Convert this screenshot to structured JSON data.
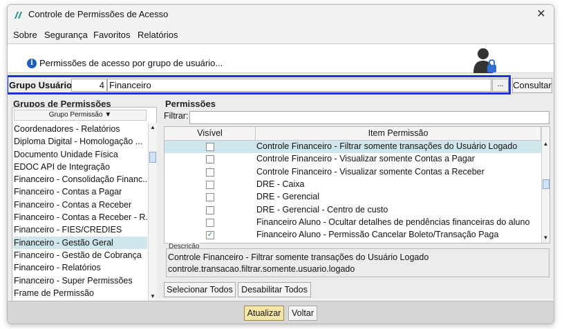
{
  "window": {
    "title": "Controle de Permissões de Acesso",
    "close_glyph": "✕"
  },
  "menu": [
    "Sobre",
    "Segurança",
    "Favoritos",
    "Relatórios"
  ],
  "info": {
    "text": "Permissões de acesso por grupo de usuário...",
    "icon": "info-icon"
  },
  "group": {
    "label": "Grupo Usuário:",
    "id": "4",
    "name": "Financeiro",
    "lookup_label": "...",
    "consult_label": "Consultar"
  },
  "left_panel": {
    "title": "Grupos de Permissões",
    "column_header": "Grupo Permissão ▼",
    "items": [
      "Coordenadores - Relatórios",
      "Diploma Digital - Homologação ...",
      "Documento Unidade Física",
      "EDOC API de Integração",
      "Financeiro - Consolidação Financ...",
      "Financeiro - Contas a Pagar",
      "Financeiro - Contas a Receber",
      "Financeiro - Contas a Receber - R...",
      "Financeiro - FIES/CREDIES",
      "Financeiro - Gestão Geral",
      "Financeiro - Gestão de Cobrança",
      "Financeiro - Relatórios",
      "Financeiro - Super Permissões",
      "Frame de Permissão"
    ],
    "selected_index": 9
  },
  "right_panel": {
    "title": "Permissões",
    "filter_label": "Filtrar:",
    "filter_value": "",
    "columns": [
      "Visível",
      "Item Permissão"
    ],
    "rows": [
      {
        "visible": false,
        "item": "Controle Financeiro - Filtrar somente transações do Usuário Logado",
        "selected": true
      },
      {
        "visible": false,
        "item": "Controle Financeiro - Visualizar somente Contas a Pagar",
        "selected": false
      },
      {
        "visible": false,
        "item": "Controle Financeiro - Visualizar somente Contas a Receber",
        "selected": false
      },
      {
        "visible": false,
        "item": "DRE - Caixa",
        "selected": false
      },
      {
        "visible": false,
        "item": "DRE - Gerencial",
        "selected": false
      },
      {
        "visible": false,
        "item": "DRE - Gerencial - Centro de custo",
        "selected": false
      },
      {
        "visible": false,
        "item": "Financeiro Aluno - Ocultar detalhes de pendências financeiras do aluno",
        "selected": false
      },
      {
        "visible": true,
        "item": "Financeiro Aluno - Permissão Cancelar Boleto/Transação Paga",
        "selected": false
      }
    ],
    "description": {
      "label": "Descrição",
      "line1": "Controle Financeiro - Filtrar somente transações do Usuário Logado",
      "line2": "controle.transacao.filtrar.somente.usuario.logado"
    },
    "select_all_label": "Selecionar Todos",
    "disable_all_label": "Desabilitar Todos"
  },
  "footer": {
    "update_label": "Atualizar",
    "back_label": "Voltar"
  },
  "colors": {
    "accent_border": "#1a33d1",
    "selection": "#cfe6ec",
    "update_button": "#f5e6a8"
  }
}
